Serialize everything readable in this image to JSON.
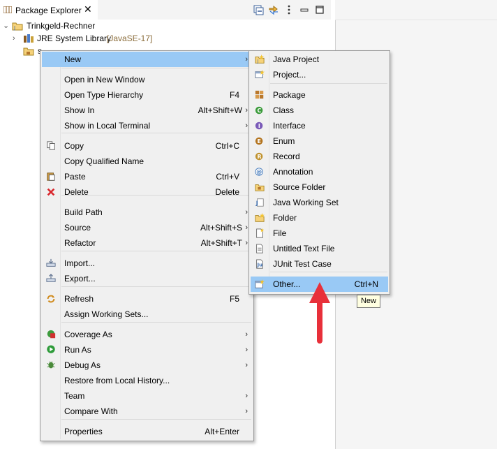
{
  "view": {
    "tab_label": "Package Explorer",
    "close_glyph": "✕",
    "toolbar_icons": [
      "collapse-all-icon",
      "link-editor-icon",
      "view-menu-icon",
      "minimize-icon",
      "maximize-icon"
    ]
  },
  "tree": {
    "project": "Trinkgeld-Rechner",
    "library": "JRE System Library",
    "library_version": "[JavaSE-17]",
    "src_partial": "s"
  },
  "context_menu": {
    "items": [
      {
        "label": "New",
        "accel": "",
        "submenu": true,
        "highlighted": true,
        "icon": ""
      },
      {
        "label": "Open in New Window",
        "accel": "",
        "submenu": false,
        "icon": ""
      },
      {
        "label": "Open Type Hierarchy",
        "accel": "F4",
        "submenu": false,
        "icon": ""
      },
      {
        "label": "Show In",
        "accel": "Alt+Shift+W",
        "submenu": true,
        "icon": ""
      },
      {
        "label": "Show in Local Terminal",
        "accel": "",
        "submenu": true,
        "icon": ""
      },
      {
        "label": "Copy",
        "accel": "Ctrl+C",
        "submenu": false,
        "icon": "copy-icon"
      },
      {
        "label": "Copy Qualified Name",
        "accel": "",
        "submenu": false,
        "icon": ""
      },
      {
        "label": "Paste",
        "accel": "Ctrl+V",
        "submenu": false,
        "icon": "paste-icon"
      },
      {
        "label": "Delete",
        "accel": "Delete",
        "submenu": false,
        "icon": "delete-icon"
      },
      {
        "label": "Build Path",
        "accel": "",
        "submenu": true,
        "icon": ""
      },
      {
        "label": "Source",
        "accel": "Alt+Shift+S",
        "submenu": true,
        "icon": ""
      },
      {
        "label": "Refactor",
        "accel": "Alt+Shift+T",
        "submenu": true,
        "icon": ""
      },
      {
        "label": "Import...",
        "accel": "",
        "submenu": false,
        "icon": "import-icon"
      },
      {
        "label": "Export...",
        "accel": "",
        "submenu": false,
        "icon": "export-icon"
      },
      {
        "label": "Refresh",
        "accel": "F5",
        "submenu": false,
        "icon": "refresh-icon"
      },
      {
        "label": "Assign Working Sets...",
        "accel": "",
        "submenu": false,
        "icon": ""
      },
      {
        "label": "Coverage As",
        "accel": "",
        "submenu": true,
        "icon": "coverage-icon"
      },
      {
        "label": "Run As",
        "accel": "",
        "submenu": true,
        "icon": "run-icon"
      },
      {
        "label": "Debug As",
        "accel": "",
        "submenu": true,
        "icon": "debug-icon"
      },
      {
        "label": "Restore from Local History...",
        "accel": "",
        "submenu": false,
        "icon": ""
      },
      {
        "label": "Team",
        "accel": "",
        "submenu": true,
        "icon": ""
      },
      {
        "label": "Compare With",
        "accel": "",
        "submenu": true,
        "icon": ""
      },
      {
        "label": "Properties",
        "accel": "Alt+Enter",
        "submenu": false,
        "icon": ""
      }
    ]
  },
  "new_submenu": {
    "items": [
      {
        "label": "Java Project",
        "accel": "",
        "icon": "java-project-icon"
      },
      {
        "label": "Project...",
        "accel": "",
        "icon": "project-icon"
      },
      {
        "label": "Package",
        "accel": "",
        "icon": "package-icon"
      },
      {
        "label": "Class",
        "accel": "",
        "icon": "class-icon"
      },
      {
        "label": "Interface",
        "accel": "",
        "icon": "interface-icon"
      },
      {
        "label": "Enum",
        "accel": "",
        "icon": "enum-icon"
      },
      {
        "label": "Record",
        "accel": "",
        "icon": "record-icon"
      },
      {
        "label": "Annotation",
        "accel": "",
        "icon": "annotation-icon"
      },
      {
        "label": "Source Folder",
        "accel": "",
        "icon": "source-folder-icon"
      },
      {
        "label": "Java Working Set",
        "accel": "",
        "icon": "working-set-icon"
      },
      {
        "label": "Folder",
        "accel": "",
        "icon": "folder-icon"
      },
      {
        "label": "File",
        "accel": "",
        "icon": "file-icon"
      },
      {
        "label": "Untitled Text File",
        "accel": "",
        "icon": "text-file-icon"
      },
      {
        "label": "JUnit Test Case",
        "accel": "",
        "icon": "junit-icon"
      },
      {
        "label": "Other...",
        "accel": "Ctrl+N",
        "icon": "other-wizard-icon",
        "highlighted": true
      }
    ]
  },
  "tooltip": "New",
  "colors": {
    "highlight": "#99c9f5",
    "menu_bg": "#f0f0f0",
    "arrow": "#e8303a",
    "delete_icon": "#d9252b",
    "run_icon": "#2e9b3a",
    "class_icon": "#3b9b3b",
    "interface_icon": "#7a5ab8",
    "enum_icon": "#b3741f"
  }
}
